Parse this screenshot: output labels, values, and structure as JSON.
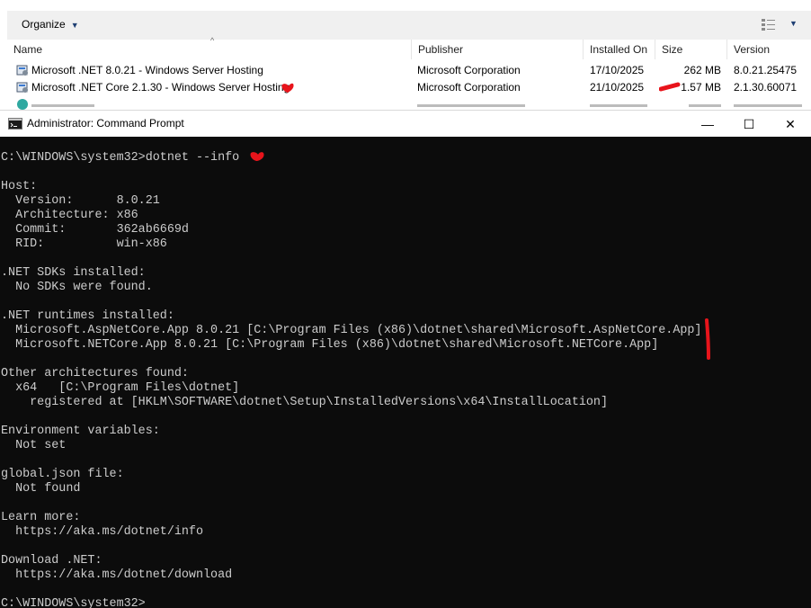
{
  "programs": {
    "toolbar": {
      "organize_label": "Organize",
      "view_icon": "details-view-icon"
    },
    "columns": [
      "Name",
      "Publisher",
      "Installed On",
      "Size",
      "Version"
    ],
    "rows": [
      {
        "name": "Microsoft .NET 8.0.21 - Windows Server Hosting",
        "publisher": "Microsoft Corporation",
        "installed_on": "17/10/2025",
        "size": "262 MB",
        "version": "8.0.21.25475"
      },
      {
        "name": "Microsoft .NET Core 2.1.30 - Windows Server Hosting",
        "publisher": "Microsoft Corporation",
        "installed_on": "21/10/2025",
        "size": "1.57 MB",
        "version": "2.1.30.60071"
      }
    ]
  },
  "cmd": {
    "title": "Administrator: Command Prompt",
    "controls": {
      "minimize": "—",
      "maximize": "☐",
      "close": "✕"
    },
    "lines": [
      "",
      "C:\\WINDOWS\\system32>dotnet --info",
      "",
      "Host:",
      "  Version:      8.0.21",
      "  Architecture: x86",
      "  Commit:       362ab6669d",
      "  RID:          win-x86",
      "",
      ".NET SDKs installed:",
      "  No SDKs were found.",
      "",
      ".NET runtimes installed:",
      "  Microsoft.AspNetCore.App 8.0.21 [C:\\Program Files (x86)\\dotnet\\shared\\Microsoft.AspNetCore.App]",
      "  Microsoft.NETCore.App 8.0.21 [C:\\Program Files (x86)\\dotnet\\shared\\Microsoft.NETCore.App]",
      "",
      "Other architectures found:",
      "  x64   [C:\\Program Files\\dotnet]",
      "    registered at [HKLM\\SOFTWARE\\dotnet\\Setup\\InstalledVersions\\x64\\InstallLocation]",
      "",
      "Environment variables:",
      "  Not set",
      "",
      "global.json file:",
      "  Not found",
      "",
      "Learn more:",
      "  https://aka.ms/dotnet/info",
      "",
      "Download .NET:",
      "  https://aka.ms/dotnet/download",
      "",
      "C:\\WINDOWS\\system32>"
    ]
  },
  "colors": {
    "console_bg": "#0c0c0c",
    "console_fg": "#cccccc",
    "annotation_red": "#e8141b"
  }
}
